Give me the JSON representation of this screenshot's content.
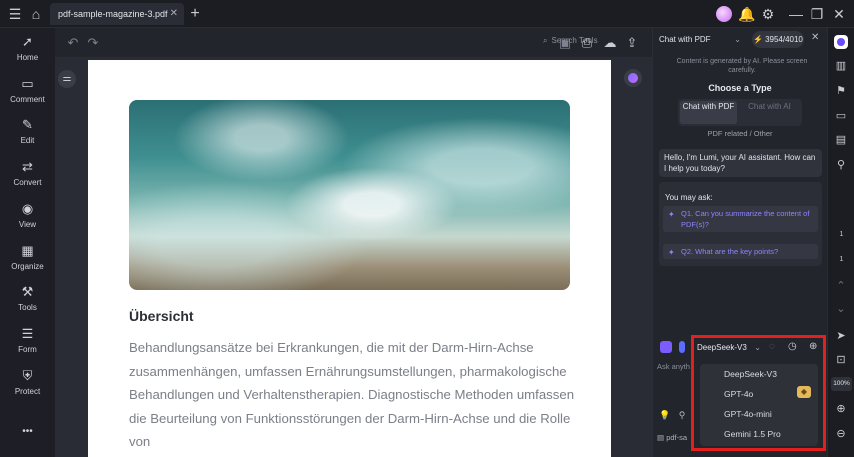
{
  "titlebar": {
    "tab_title": "pdf-sample-magazine-3.pdf",
    "tab_close": "✕",
    "new_tab": "+"
  },
  "sidebar": {
    "items": [
      {
        "label": "Home",
        "icon": "rocket-icon",
        "glyph": "🚀"
      },
      {
        "label": "Comment",
        "icon": "comment-icon",
        "glyph": "▭"
      },
      {
        "label": "Edit",
        "icon": "edit-icon",
        "glyph": "✎"
      },
      {
        "label": "Convert",
        "icon": "convert-icon",
        "glyph": "⇄"
      },
      {
        "label": "View",
        "icon": "view-icon",
        "glyph": "◉"
      },
      {
        "label": "Organize",
        "icon": "organize-icon",
        "glyph": "▦"
      },
      {
        "label": "Tools",
        "icon": "tools-icon",
        "glyph": "⚒"
      },
      {
        "label": "Form",
        "icon": "form-icon",
        "glyph": "☰"
      },
      {
        "label": "Protect",
        "icon": "protect-icon",
        "glyph": "⛨"
      }
    ],
    "more": "•••"
  },
  "toolbar": {
    "search_tools": "Search Tools"
  },
  "document": {
    "heading": "Übersicht",
    "body": "Behandlungsansätze bei Erkrankungen, die mit der Darm-Hirn-Achse zusammenhängen, umfassen Ernährungsumstellungen, pharmakologische Behandlungen und Verhaltenstherapien. Diagnostische Methoden umfassen die Beurteilung von Funktionsstörungen der Darm-Hirn-Achse und die Rolle von"
  },
  "chat": {
    "mode": "Chat with PDF",
    "credits": "3954/4010",
    "disclaimer": "Content is generated by AI. Please screen carefully.",
    "choose_type": "Choose a Type",
    "seg_a": "Chat with PDF",
    "seg_b": "Chat with AI",
    "pdf_related": "PDF related / Other",
    "greeting": "Hello, I'm Lumi, your AI assistant. How can I help you today?",
    "you_may_ask": "You may ask:",
    "q1": "Q1. Can you summarize the content of PDF(s)?",
    "q2": "Q2. What are the key points?",
    "model": "DeepSeek-V3",
    "ask_placeholder": "Ask anyth",
    "pdf_chip": "pdf-sa"
  },
  "model_dropdown": {
    "options": [
      "DeepSeek-V3",
      "GPT-4o",
      "GPT-4o-mini",
      "Gemini 1.5 Pro"
    ]
  },
  "rail": {
    "page_current": "1",
    "page_total": "1",
    "zoom": "100%"
  },
  "colors": {
    "accent": "#8d86ff",
    "highlight_box": "#e3201e"
  }
}
